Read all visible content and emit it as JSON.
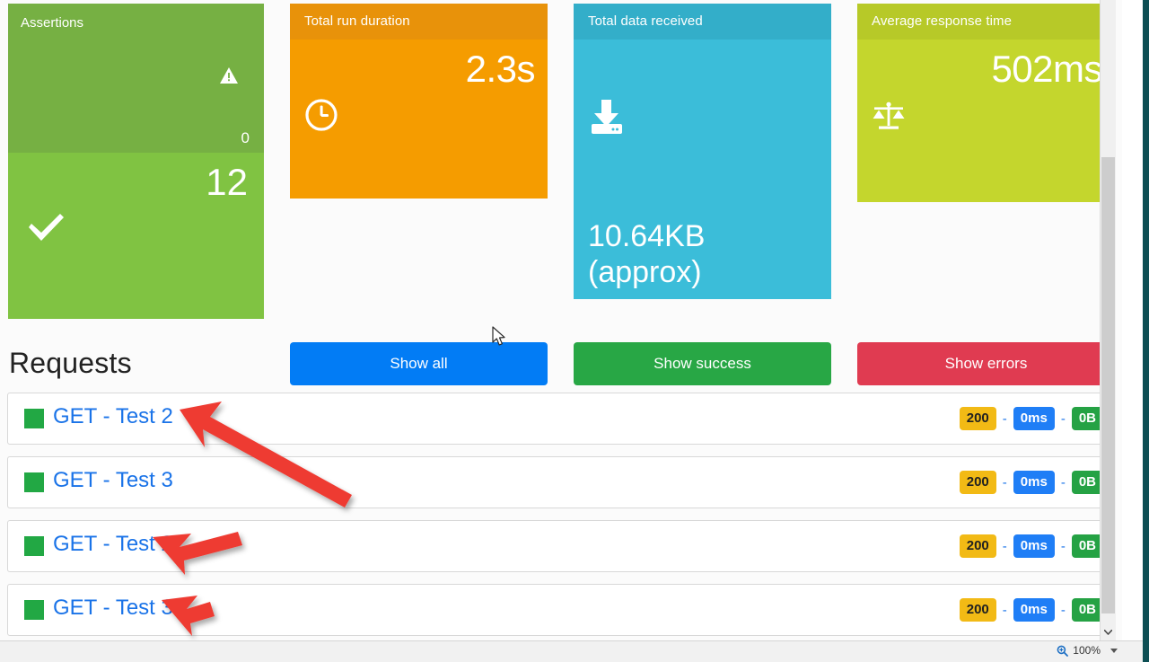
{
  "cards": {
    "assertions": {
      "title": "Assertions",
      "failed_count": "0",
      "passed_count": "12",
      "warn_icon": "warning-triangle-icon",
      "pass_icon": "check-icon",
      "color_top": "#76b043",
      "color_bottom": "#80c342"
    },
    "duration": {
      "title": "Total run duration",
      "value": "2.3s",
      "icon": "clock-icon",
      "color": "#f59c00"
    },
    "data_received": {
      "title": "Total data received",
      "value": "10.64KB",
      "value_note": "(approx)",
      "icon": "download-icon",
      "color": "#3bbdd9"
    },
    "response_time": {
      "title": "Average response time",
      "value": "502ms",
      "icon": "scales-icon",
      "color": "#c4d62d"
    }
  },
  "requests": {
    "heading": "Requests",
    "filters": [
      {
        "label": "Show all",
        "color": "#027cf5"
      },
      {
        "label": "Show success",
        "color": "#28a745"
      },
      {
        "label": "Show errors",
        "color": "#e03b51"
      }
    ],
    "rows": [
      {
        "method": "GET",
        "sep": "-",
        "name": "Test 2",
        "status": "200",
        "time": "0ms",
        "size": "0B"
      },
      {
        "method": "GET",
        "sep": "-",
        "name": "Test 3",
        "status": "200",
        "time": "0ms",
        "size": "0B"
      },
      {
        "method": "GET",
        "sep": "-",
        "name": "Test 2",
        "status": "200",
        "time": "0ms",
        "size": "0B"
      },
      {
        "method": "GET",
        "sep": "-",
        "name": "Test 3",
        "status": "200",
        "time": "0ms",
        "size": "0B"
      }
    ],
    "badge_separator": "-"
  },
  "statusbar": {
    "zoom_level": "100%",
    "zoom_icon": "zoom-magnifier-icon"
  },
  "annotations": {
    "arrow_color": "#ee3b33",
    "count": 3
  }
}
